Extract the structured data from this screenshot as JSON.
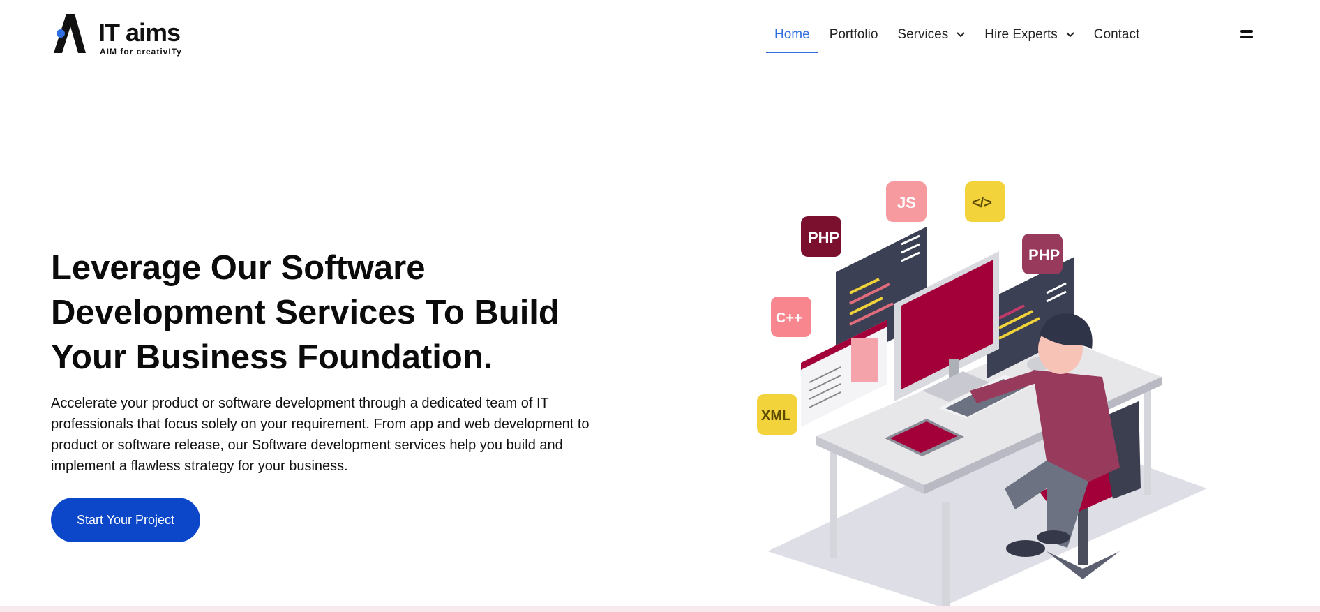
{
  "brand": {
    "name": "IT aims",
    "tagline": "AIM for creativITy"
  },
  "nav": {
    "items": [
      {
        "label": "Home",
        "active": true
      },
      {
        "label": "Portfolio"
      },
      {
        "label": "Services",
        "has_dropdown": true
      },
      {
        "label": "Hire Experts",
        "has_dropdown": true
      },
      {
        "label": "Contact"
      }
    ]
  },
  "hero": {
    "title_lines": [
      "Leverage Our Software",
      "Development Services To Build",
      "Your Business Foundation."
    ],
    "description_lines": [
      "Accelerate your product or software development through a dedicated team of IT",
      "professionals that focus solely on your requirement. From app and web development to",
      "product or software release, our Software development services help you build and",
      "implement a flawless strategy for your business."
    ],
    "cta_label": "Start Your Project"
  },
  "illustration": {
    "badges": [
      "PHP",
      "JS",
      "</>",
      "PHP",
      "C++",
      "XML"
    ]
  },
  "colors": {
    "accent": "#2f6fe0",
    "cta": "#0b47c8",
    "brand_dot": "#2f6fe0",
    "crimson": "#a3003a",
    "mauve": "#983a5c"
  },
  "icons": {
    "dropdown": "chevron-down-icon",
    "menu": "hamburger-menu-icon"
  }
}
